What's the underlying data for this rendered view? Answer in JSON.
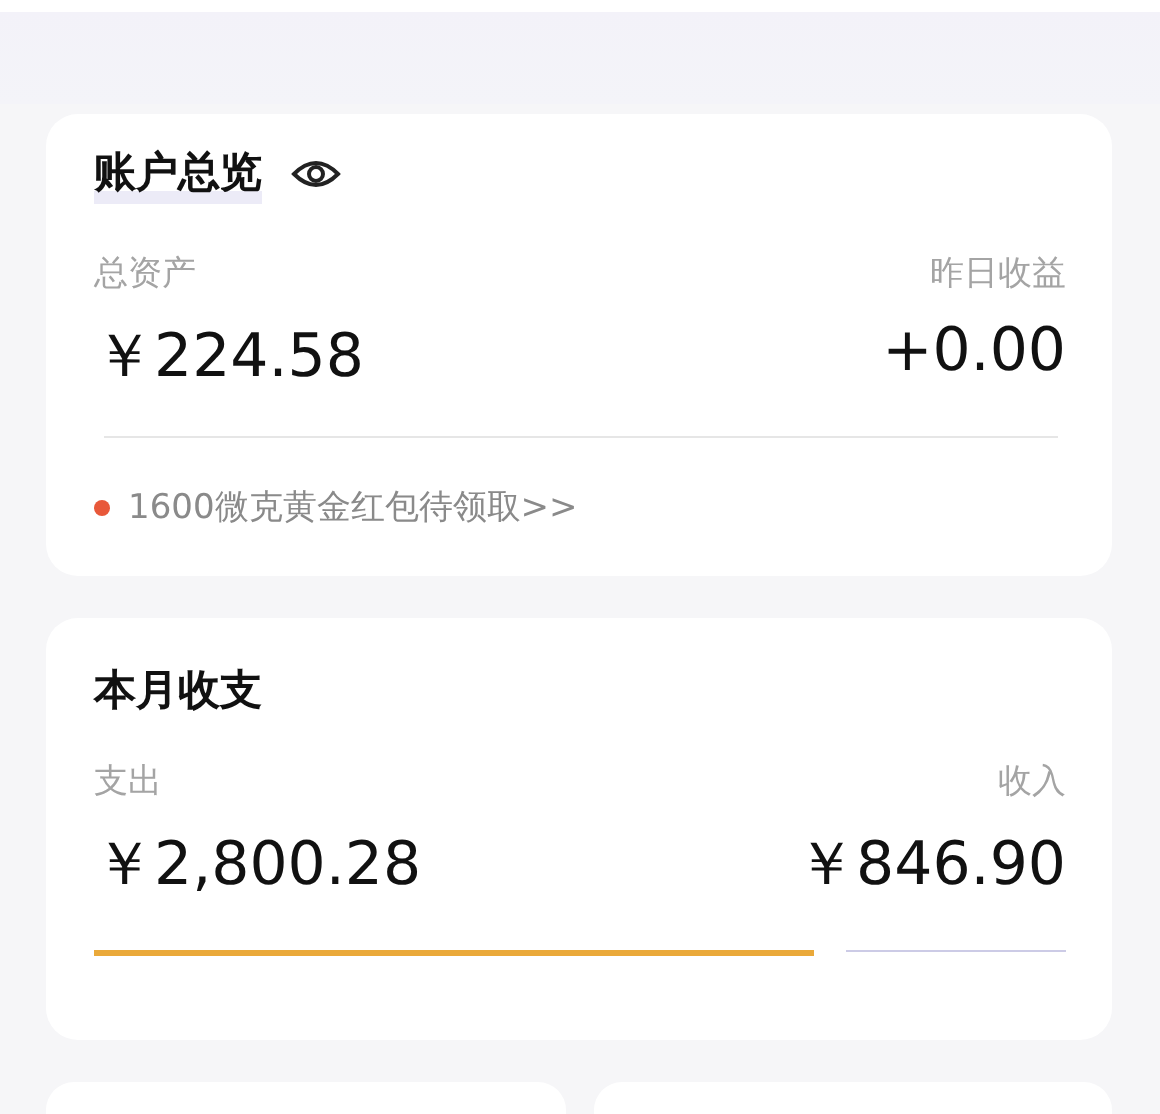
{
  "account_overview": {
    "title": "账户总览",
    "total_assets_label": "总资产",
    "total_assets": "￥224.58",
    "yesterday_income_label": "昨日收益",
    "yesterday_income": "+0.00",
    "notice": "1600微克黄金红包待领取>>"
  },
  "monthly": {
    "title": "本月收支",
    "expense_label": "支出",
    "expense": "￥2,800.28",
    "income_label": "收入",
    "income": "￥846.90",
    "level": 0.74
  }
}
